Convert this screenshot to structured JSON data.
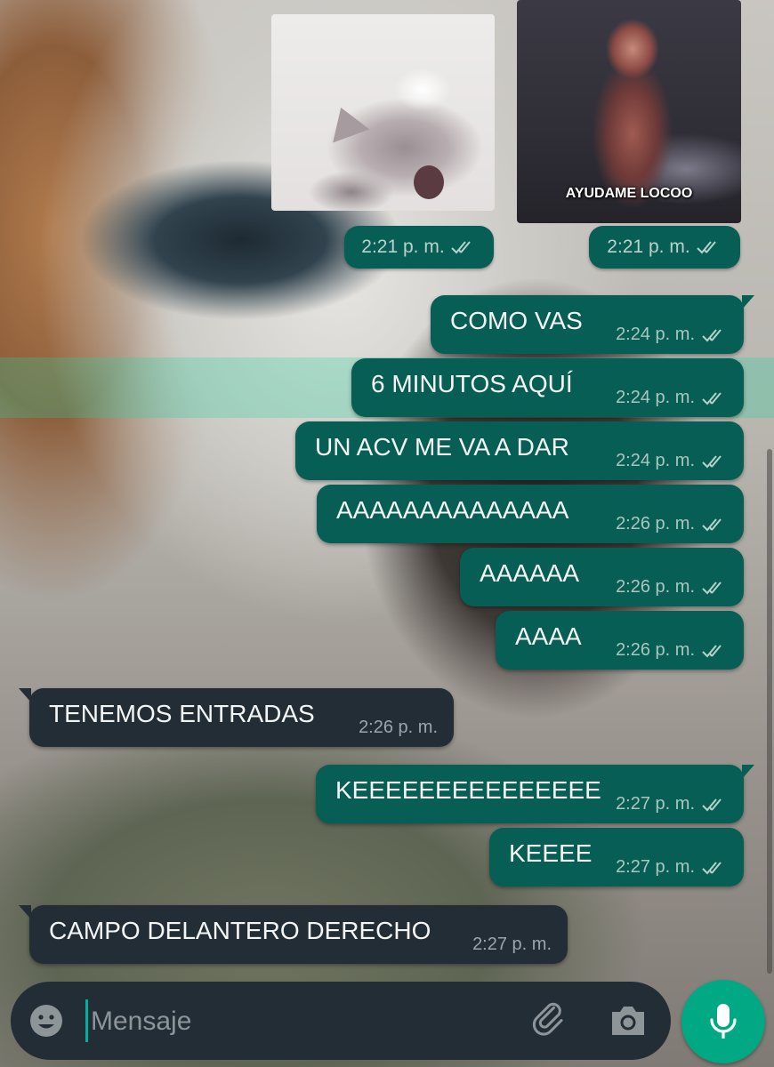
{
  "composer": {
    "placeholder": "Mensaje"
  },
  "media_messages": [
    {
      "time": "2:21 p. m."
    },
    {
      "caption": "AYUDAME LOCOO",
      "time": "2:21 p. m."
    }
  ],
  "messages": [
    {
      "direction": "out",
      "text": "COMO VAS",
      "time": "2:24 p. m."
    },
    {
      "direction": "out",
      "text": "6 MINUTOS AQUÍ",
      "time": "2:24 p. m."
    },
    {
      "direction": "out",
      "text": "UN ACV ME VA A DAR",
      "time": "2:24 p. m."
    },
    {
      "direction": "out",
      "text": "AAAAAAAAAAAAAA",
      "time": "2:26 p. m."
    },
    {
      "direction": "out",
      "text": "AAAAAA",
      "time": "2:26 p. m."
    },
    {
      "direction": "out",
      "text": "AAAA",
      "time": "2:26 p. m."
    },
    {
      "direction": "in",
      "text": "TENEMOS ENTRADAS",
      "time": "2:26 p. m."
    },
    {
      "direction": "out",
      "text": "KEEEEEEEEEEEEEEE",
      "time": "2:27 p. m."
    },
    {
      "direction": "out",
      "text": "KEEEE",
      "time": "2:27 p. m."
    },
    {
      "direction": "in",
      "text": "CAMPO DELANTERO DERECHO",
      "time": "2:27 p. m."
    }
  ],
  "colors": {
    "outgoing_bubble": "#075e54",
    "incoming_bubble": "#232d36",
    "accent": "#00a884",
    "read_ticks": "#b9d2cd"
  },
  "icons": {
    "emoji": "emoji-icon",
    "attach": "paperclip-icon",
    "camera": "camera-icon",
    "mic": "microphone-icon",
    "status": "double-check-icon"
  }
}
